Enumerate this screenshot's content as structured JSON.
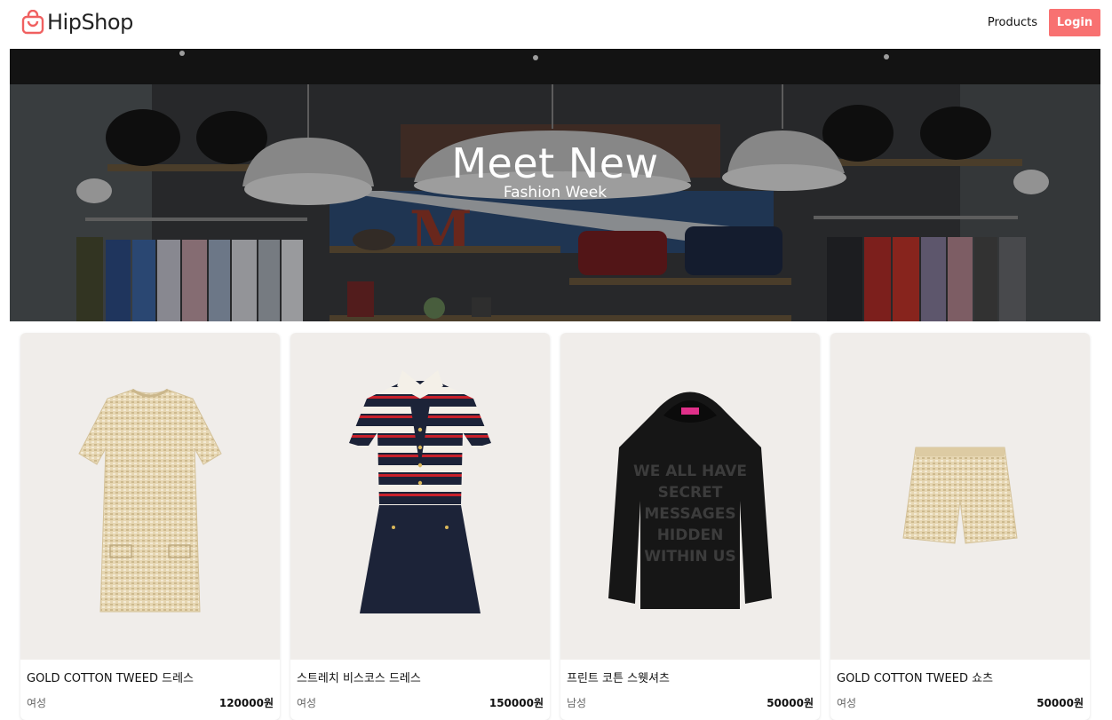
{
  "app": {
    "brand": "HipShop",
    "colors": {
      "accent": "#f87171",
      "brand_icon": "#f06060",
      "card_bg": "#f0edea"
    }
  },
  "nav": {
    "products_label": "Products",
    "login_label": "Login"
  },
  "hero": {
    "title": "Meet New",
    "subtitle": "Fashion Week",
    "background_sign": "M"
  },
  "products": [
    {
      "name": "GOLD COTTON TWEED 드레스",
      "category": "여성",
      "price": "120000원",
      "image": "tweed-dress"
    },
    {
      "name": "스트레치 비스코스 드레스",
      "category": "여성",
      "price": "150000원",
      "image": "striped-dress"
    },
    {
      "name": "프린트 코튼 스웻셔츠",
      "category": "남성",
      "price": "50000원",
      "image": "black-hoodie",
      "print": [
        "WE ALL HAVE",
        "SECRET",
        "MESSAGES",
        "HIDDEN",
        "WITHIN US"
      ]
    },
    {
      "name": "GOLD COTTON TWEED 쇼츠",
      "category": "여성",
      "price": "50000원",
      "image": "tweed-shorts"
    }
  ]
}
